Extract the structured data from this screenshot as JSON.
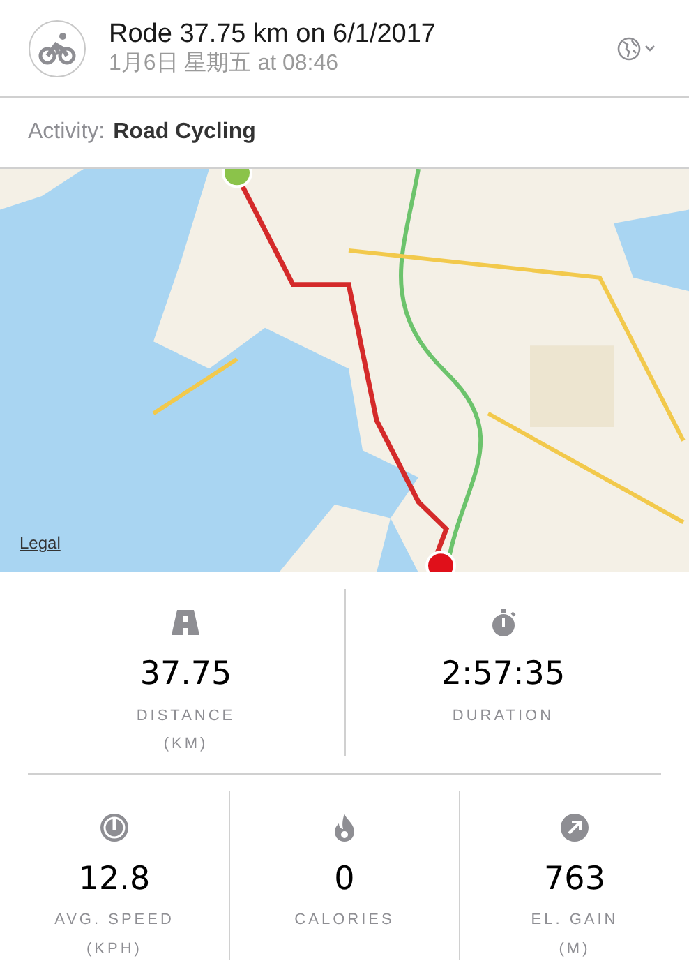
{
  "header": {
    "title": "Rode 37.75 km on 6/1/2017",
    "subtitle": "1月6日 星期五 at 08:46"
  },
  "activity": {
    "label": "Activity:",
    "value": "Road Cycling"
  },
  "map": {
    "kind": "picture",
    "legal": "Legal"
  },
  "stat_rows": [
    [
      {
        "kind": "road",
        "value": "37.75",
        "label": "DISTANCE",
        "unit": "(KM)"
      },
      {
        "kind": "stopwatch",
        "value": "2:57:35",
        "label": "DURATION"
      }
    ],
    [
      {
        "kind": "speed",
        "value": "12.8",
        "label": "AVG. SPEED",
        "unit": "(KPH)"
      },
      {
        "kind": "flame",
        "value": "0",
        "label": "CALORIES"
      },
      {
        "kind": "elevation",
        "value": "763",
        "label": "EL. GAIN",
        "unit": "(M)"
      }
    ]
  ]
}
